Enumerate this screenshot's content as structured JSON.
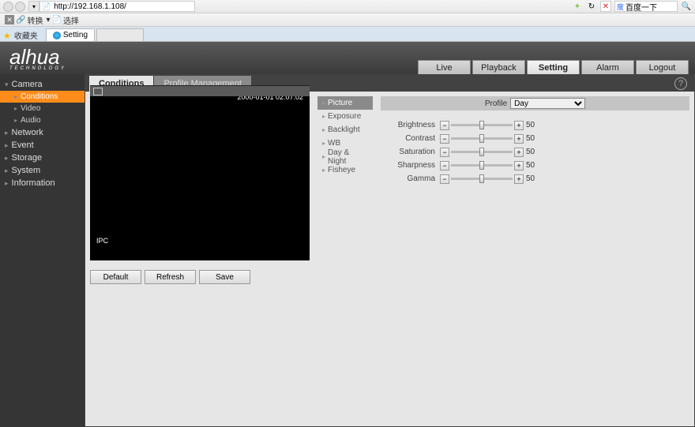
{
  "browser": {
    "url": "http://192.168.1.108/",
    "search_placeholder": "百度一下",
    "links_text1": "转换",
    "links_text2": "选择",
    "favorites": "收藏夹",
    "tab_title": "Setting"
  },
  "nav": {
    "live": "Live",
    "playback": "Playback",
    "setting": "Setting",
    "alarm": "Alarm",
    "logout": "Logout"
  },
  "sidebar": {
    "camera": "Camera",
    "conditions": "Conditions",
    "video": "Video",
    "audio": "Audio",
    "network": "Network",
    "event": "Event",
    "storage": "Storage",
    "system": "System",
    "information": "Information"
  },
  "subTabs": {
    "conditions": "Conditions",
    "profile_mgmt": "Profile Management"
  },
  "video": {
    "timestamp": "2000-01-01 02:07:02",
    "label": "IPC"
  },
  "buttons": {
    "default": "Default",
    "refresh": "Refresh",
    "save": "Save"
  },
  "picMenu": {
    "picture": "Picture",
    "exposure": "Exposure",
    "backlight": "Backlight",
    "wb": "WB",
    "daynight": "Day & Night",
    "fisheye": "Fisheye"
  },
  "profile": {
    "label": "Profile",
    "value": "Day"
  },
  "sliders": {
    "brightness": {
      "label": "Brightness",
      "value": "50"
    },
    "contrast": {
      "label": "Contrast",
      "value": "50"
    },
    "saturation": {
      "label": "Saturation",
      "value": "50"
    },
    "sharpness": {
      "label": "Sharpness",
      "value": "50"
    },
    "gamma": {
      "label": "Gamma",
      "value": "50"
    }
  }
}
